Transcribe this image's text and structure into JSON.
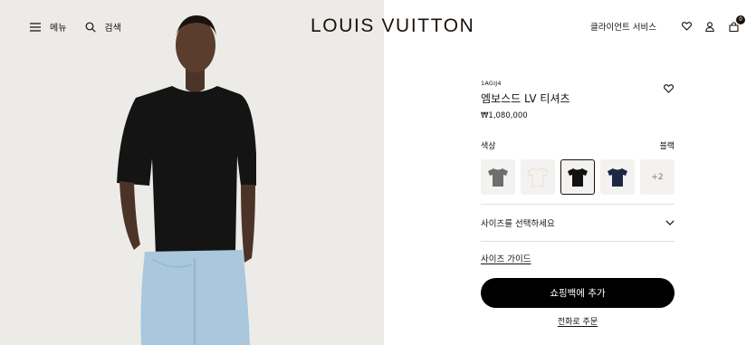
{
  "header": {
    "menu_label": "메뉴",
    "search_label": "검색",
    "logo": "LOUIS VUITTON",
    "client_service": "클라이언트 서비스",
    "bag_count": "0",
    "icons": [
      "hamburger-icon",
      "search-icon",
      "heart-icon",
      "user-icon",
      "bag-icon"
    ]
  },
  "product": {
    "sku": "1AGIJ4",
    "title": "엠보스드 LV 티셔츠",
    "price": "₩1,080,000",
    "color_label": "색상",
    "selected_color": "블랙",
    "swatches": [
      {
        "name": "grey",
        "color": "#6e6e6e"
      },
      {
        "name": "white",
        "color": "#f4f2ec"
      },
      {
        "name": "black",
        "color": "#121212",
        "selected": true
      },
      {
        "name": "navy",
        "color": "#1c2743"
      }
    ],
    "more_colors": "+2",
    "size_select": "사이즈를 선택하세요",
    "size_guide": "사이즈 가이드",
    "add_to_bag": "쇼핑백에 추가",
    "phone_order": "전화로 주문"
  }
}
